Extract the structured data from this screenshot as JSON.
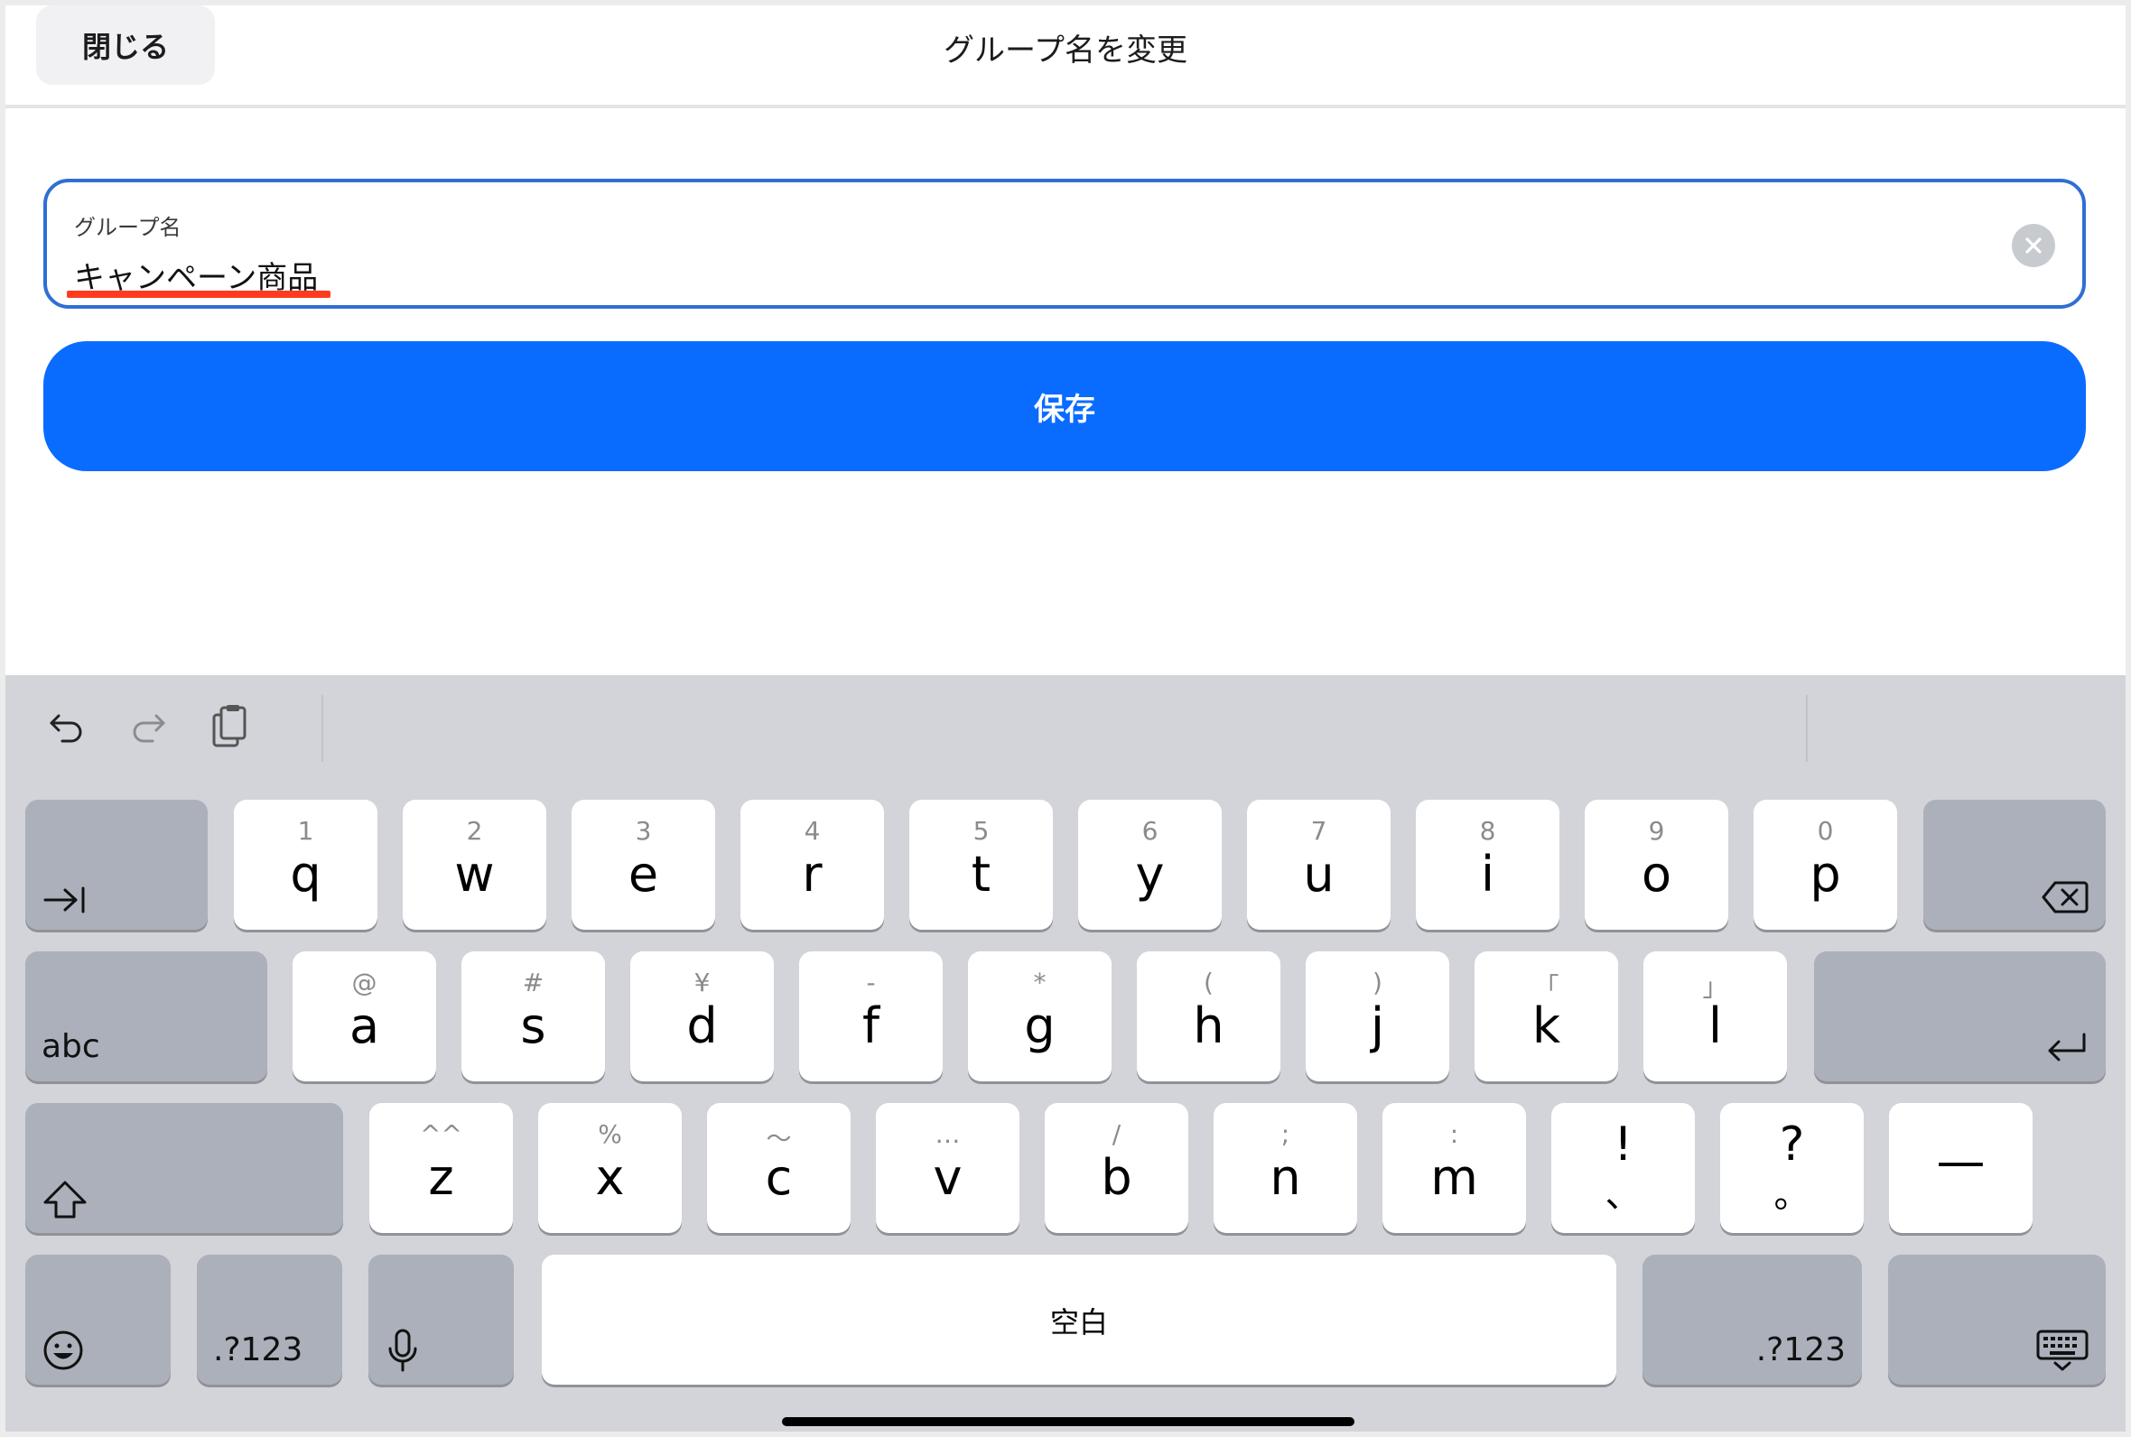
{
  "header": {
    "close_label": "閉じる",
    "title": "グループ名を変更"
  },
  "form": {
    "field_label": "グループ名",
    "field_value": "キャンペーン商品",
    "save_label": "保存"
  },
  "keyboard": {
    "row1": [
      {
        "sec": "1",
        "pri": "q"
      },
      {
        "sec": "2",
        "pri": "w"
      },
      {
        "sec": "3",
        "pri": "e"
      },
      {
        "sec": "4",
        "pri": "r"
      },
      {
        "sec": "5",
        "pri": "t"
      },
      {
        "sec": "6",
        "pri": "y"
      },
      {
        "sec": "7",
        "pri": "u"
      },
      {
        "sec": "8",
        "pri": "i"
      },
      {
        "sec": "9",
        "pri": "o"
      },
      {
        "sec": "0",
        "pri": "p"
      }
    ],
    "row2": [
      {
        "sec": "@",
        "pri": "a"
      },
      {
        "sec": "#",
        "pri": "s"
      },
      {
        "sec": "¥",
        "pri": "d"
      },
      {
        "sec": "-",
        "pri": "f"
      },
      {
        "sec": "*",
        "pri": "g"
      },
      {
        "sec": "(",
        "pri": "h"
      },
      {
        "sec": ")",
        "pri": "j"
      },
      {
        "sec": "「",
        "pri": "k"
      },
      {
        "sec": "」",
        "pri": "l"
      }
    ],
    "row3": [
      {
        "sec": "^^",
        "pri": "z"
      },
      {
        "sec": "%",
        "pri": "x"
      },
      {
        "sec": "〜",
        "pri": "c"
      },
      {
        "sec": "…",
        "pri": "v"
      },
      {
        "sec": "/",
        "pri": "b"
      },
      {
        "sec": ";",
        "pri": "n"
      },
      {
        "sec": ":",
        "pri": "m"
      }
    ],
    "punct1": {
      "top": "!",
      "bottom": "、"
    },
    "punct2": {
      "top": "?",
      "bottom": "。"
    },
    "dash": "—",
    "abc_label": "abc",
    "num_label_left": ".?123",
    "space_label": "空白",
    "num_label_right": ".?123"
  }
}
